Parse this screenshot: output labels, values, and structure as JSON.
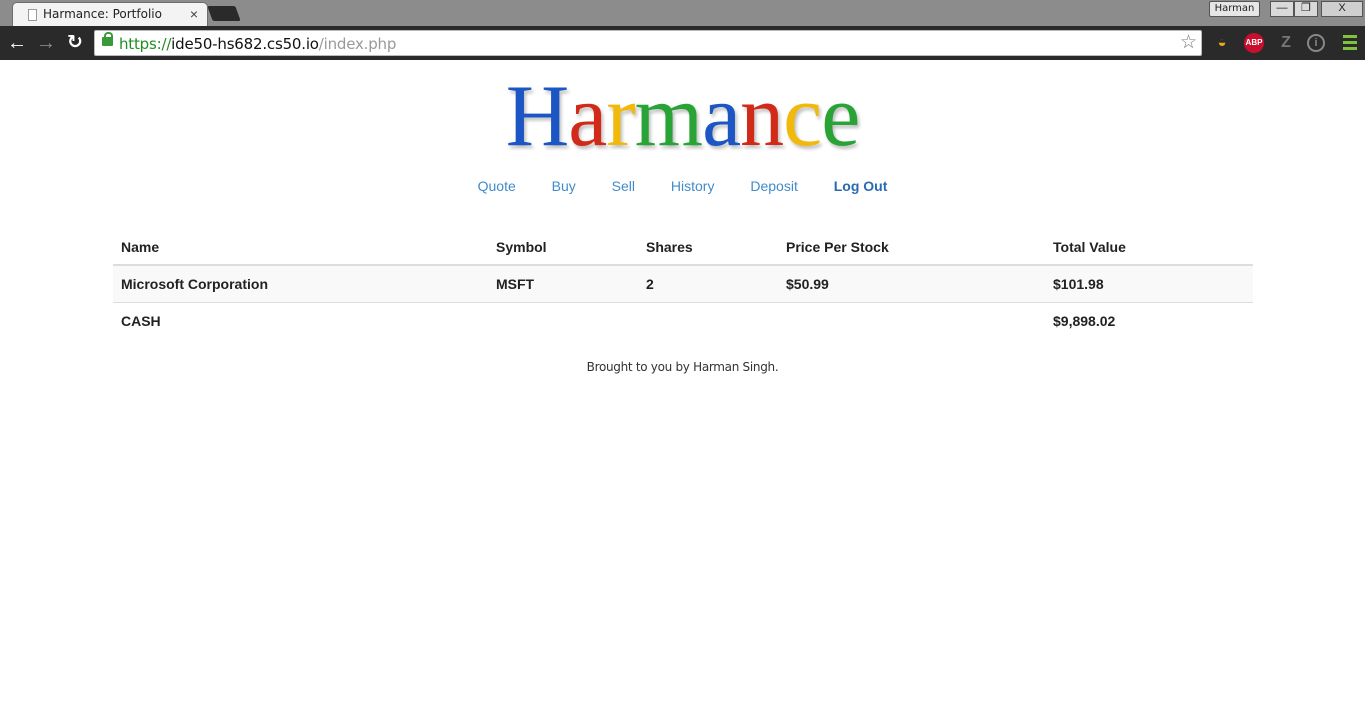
{
  "browser": {
    "tab_title": "Harmance: Portfolio",
    "tab_close": "×",
    "profile_name": "Harman",
    "window_buttons": {
      "minimize": "—",
      "maximize": "❐",
      "close": "X"
    },
    "nav": {
      "back": "←",
      "forward": "→",
      "reload": "↻"
    },
    "url": {
      "scheme": "https://",
      "host": "ide50-hs682.cs50.io",
      "path": "/index.php"
    },
    "bookmark_star": "☆",
    "extensions": [
      {
        "name": "taco-extension-icon",
        "glyph": "◒"
      },
      {
        "name": "adblock-plus-icon",
        "glyph": "ABP"
      },
      {
        "name": "z-extension-icon",
        "glyph": "Z"
      },
      {
        "name": "info-extension-icon",
        "glyph": "i"
      }
    ],
    "menu_icon_color": "#7fc241"
  },
  "logo": {
    "letters": [
      {
        "char": "H",
        "color": "blue"
      },
      {
        "char": "a",
        "color": "red"
      },
      {
        "char": "r",
        "color": "yellow"
      },
      {
        "char": "m",
        "color": "green"
      },
      {
        "char": "a",
        "color": "blue"
      },
      {
        "char": "n",
        "color": "red"
      },
      {
        "char": "c",
        "color": "yellow"
      },
      {
        "char": "e",
        "color": "green"
      }
    ],
    "colors": {
      "blue": "#1c55c4",
      "red": "#d22a18",
      "yellow": "#f0b90c",
      "green": "#29a336"
    }
  },
  "nav": {
    "quote": "Quote",
    "buy": "Buy",
    "sell": "Sell",
    "history": "History",
    "deposit": "Deposit",
    "logout": "Log Out"
  },
  "table": {
    "headers": {
      "name": "Name",
      "symbol": "Symbol",
      "shares": "Shares",
      "price": "Price Per Stock",
      "total": "Total Value"
    },
    "rows": [
      {
        "name": "Microsoft Corporation",
        "symbol": "MSFT",
        "shares": "2",
        "price": "$50.99",
        "total": "$101.98"
      }
    ],
    "cash": {
      "label": "CASH",
      "total": "$9,898.02"
    }
  },
  "footer": {
    "text": "Brought to you by Harman Singh."
  }
}
